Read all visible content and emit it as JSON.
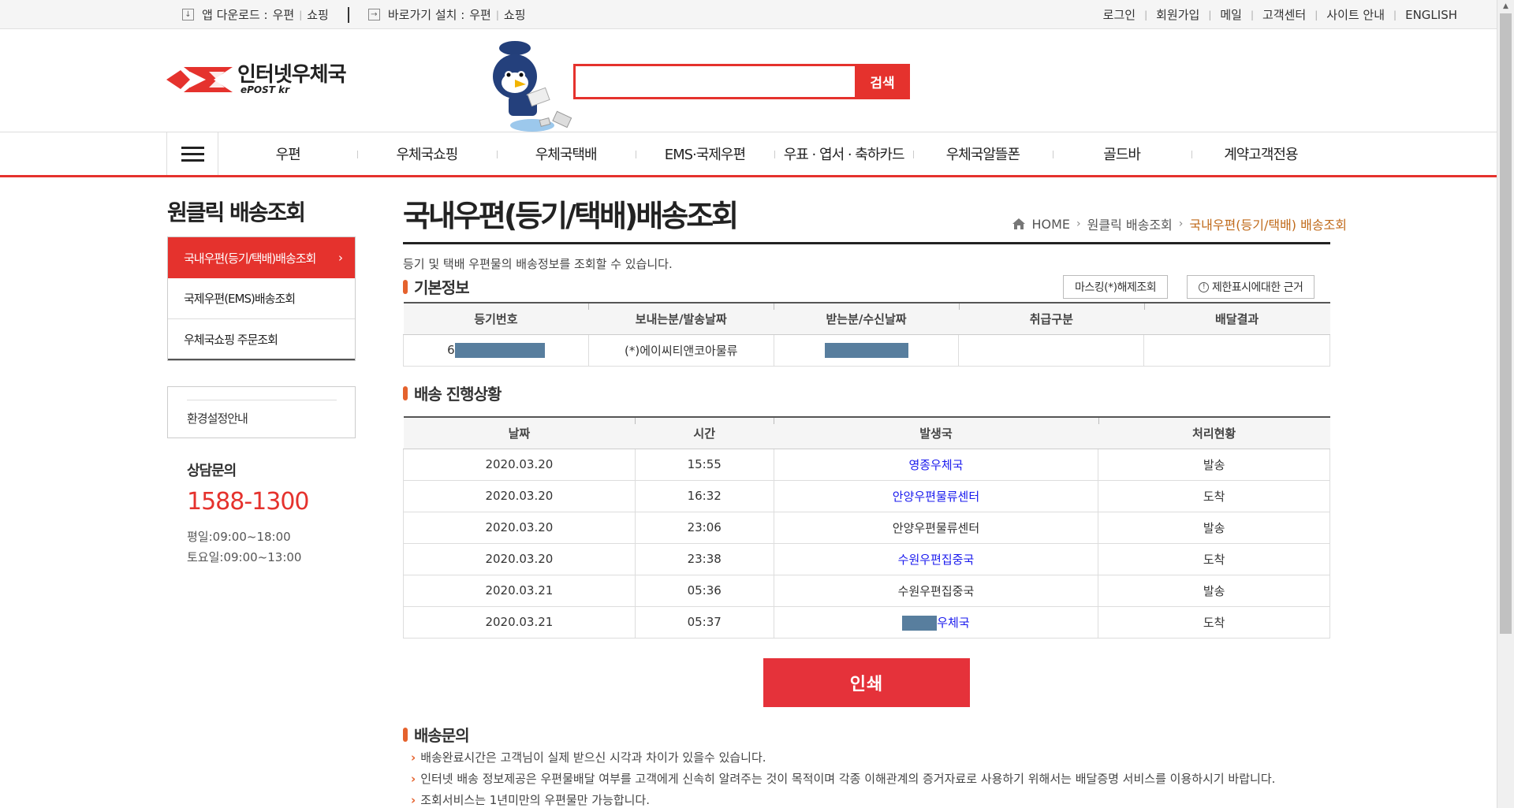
{
  "topbar": {
    "app_download_label": "앱 다운로드 :",
    "app_post": "우편",
    "app_shopping": "쇼핑",
    "shortcut_label": "바로가기 설치 :",
    "shortcut_post": "우편",
    "shortcut_shopping": "쇼핑",
    "links": [
      "로그인",
      "회원가입",
      "메일",
      "고객센터",
      "사이트 안내",
      "ENGLISH"
    ]
  },
  "logo": {
    "name": "인터넷우체국",
    "sub": "ePOST kr"
  },
  "search": {
    "value": "",
    "button": "검색"
  },
  "nav": {
    "items": [
      "우편",
      "우체국쇼핑",
      "우체국택배",
      "EMS·국제우편",
      "우표 · 엽서 · 축하카드",
      "우체국알뜰폰",
      "골드바",
      "계약고객전용"
    ]
  },
  "sidebar": {
    "title": "원클릭 배송조회",
    "items": [
      "국내우편(등기/택배)배송조회",
      "국제우편(EMS)배송조회",
      "우체국쇼핑 주문조회"
    ],
    "active_arrow": "›",
    "env_guide": "환경설정안내",
    "contact_label": "상담문의",
    "phone": "1588-1300",
    "hours_weekday": "평일:09:00~18:00",
    "hours_saturday": "토요일:09:00~13:00"
  },
  "content": {
    "title": "국내우편(등기/택배)배송조회",
    "breadcrumb": [
      "HOME",
      "원클릭 배송조회",
      "국내우편(등기/택배) 배송조회"
    ],
    "intro": "등기 및 택배 우편물의 배송정보를 조회할 수 있습니다.",
    "basic_info_title": "기본정보",
    "unmask_button": "마스킹(*)해제조회",
    "limit_button": "제한표시에대한 근거",
    "basic_headers": [
      "등기번호",
      "보내는분/발송날짜",
      "받는분/수신날짜",
      "취급구분",
      "배달결과"
    ],
    "basic_row": {
      "tracking_prefix": "6",
      "sender": "(*)에이씨티앤코아물류",
      "handling": "",
      "result": ""
    },
    "progress_title": "배송 진행상황",
    "progress_headers": [
      "날짜",
      "시간",
      "발생국",
      "처리현황"
    ],
    "progress_rows": [
      {
        "date": "2020.03.20",
        "time": "15:55",
        "office": "영종우체국",
        "status": "발송",
        "link": true
      },
      {
        "date": "2020.03.20",
        "time": "16:32",
        "office": "안양우편물류센터",
        "status": "도착",
        "link": true
      },
      {
        "date": "2020.03.20",
        "time": "23:06",
        "office": "안양우편물류센터",
        "status": "발송",
        "link": false
      },
      {
        "date": "2020.03.20",
        "time": "23:38",
        "office": "수원우편집중국",
        "status": "도착",
        "link": true
      },
      {
        "date": "2020.03.21",
        "time": "05:36",
        "office": "수원우편집중국",
        "status": "발송",
        "link": false
      },
      {
        "date": "2020.03.21",
        "time": "05:37",
        "office": "우체국",
        "status": "도착",
        "link": true
      }
    ],
    "print_button": "인쇄",
    "inquiry_title": "배송문의",
    "notes": [
      "배송완료시간은 고객님이 실제 받으신 시각과 차이가 있을수 있습니다.",
      "인터넷 배송 정보제공은 우편물배달 여부를 고객에게 신속히 알려주는 것이 목적이며 각종 이해관계의 증거자료로 사용하기 위해서는 배달증명 서비스를 이용하시기 바랍니다.",
      "조회서비스는 1년미만의 우편물만 가능합니다."
    ]
  },
  "colors": {
    "accent": "#e5322d",
    "link": "#1a1aee",
    "mask": "#587e9e",
    "breadcrumb_current": "#c06a1a"
  }
}
